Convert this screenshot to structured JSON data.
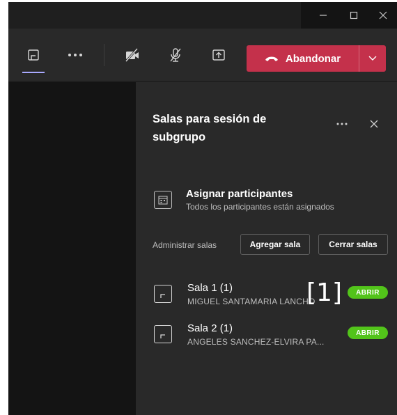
{
  "window_controls": {
    "minimize_icon": "minimize-icon",
    "maximize_icon": "maximize-icon",
    "close_icon": "close-icon"
  },
  "toolbar": {
    "icons": [
      "breakout-rooms-icon",
      "more-options-icon",
      "camera-off-icon",
      "mic-off-icon",
      "share-screen-icon"
    ],
    "leave_label": "Abandonar",
    "leave_color": "#c4314b"
  },
  "panel": {
    "title": "Salas para sesión de subgrupo",
    "assign_title": "Asignar participantes",
    "assign_subtitle": "Todos los participantes están asignados",
    "manage_label": "Administrar salas",
    "add_room_label": "Agregar sala",
    "close_rooms_label": "Cerrar salas",
    "rooms": [
      {
        "name": "Sala 1 (1)",
        "member": "MIGUEL SANTAMARIA LANCHO",
        "status": "ABRIR"
      },
      {
        "name": "Sala 2 (1)",
        "member": "ANGELES SANCHEZ-ELVIRA PA...",
        "status": "ABRIR"
      }
    ],
    "status_color": "#52c41a"
  },
  "annotation": "[1]"
}
